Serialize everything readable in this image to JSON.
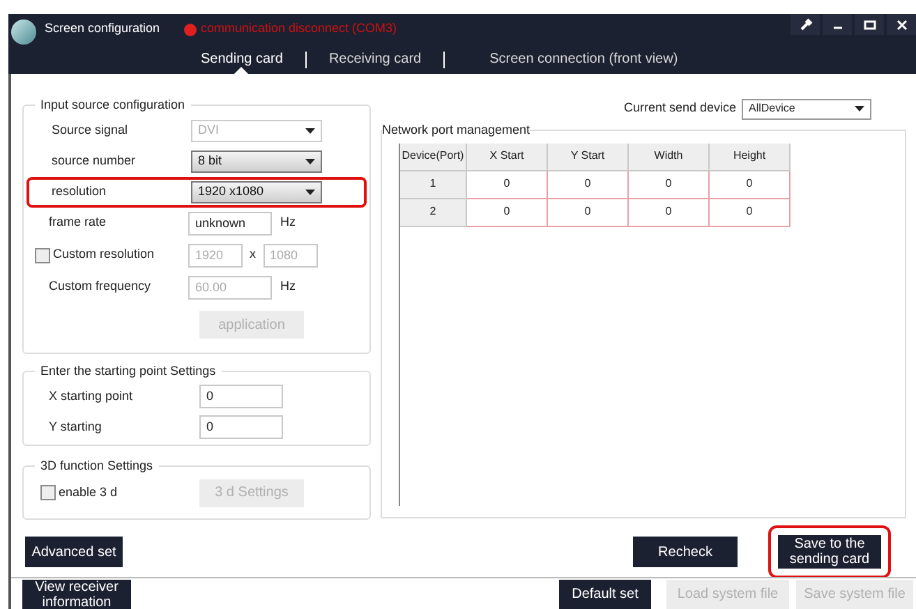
{
  "window": {
    "title": "Screen configuration",
    "status": {
      "text": "communication disconnect  (COM3)",
      "connected": false
    }
  },
  "tabs": [
    {
      "label": "Sending card",
      "selected": true
    },
    {
      "label": "Receiving card",
      "selected": false
    },
    {
      "label": "Screen connection (front view)",
      "selected": false
    }
  ],
  "input_source": {
    "legend": "Input source configuration",
    "rows": [
      {
        "kind": "select",
        "label": "Source signal",
        "value": "DVI",
        "disabled": true,
        "highlighted": false
      },
      {
        "kind": "select",
        "label": "source number",
        "value": "8 bit",
        "disabled": false,
        "highlighted": false
      },
      {
        "kind": "select",
        "label": "resolution",
        "value": "1920 x1080",
        "disabled": false,
        "highlighted": true
      },
      {
        "kind": "text",
        "label": "frame rate",
        "value": "unknown",
        "unit": "Hz",
        "disabled": false
      },
      {
        "kind": "pair",
        "label": "Custom resolution",
        "checked": false,
        "values": [
          "1920",
          "1080"
        ],
        "separator": "x",
        "disabled": true
      },
      {
        "kind": "text",
        "label": "Custom frequency",
        "value": "60.00",
        "unit": "Hz",
        "disabled": true
      }
    ],
    "button": {
      "label": "application",
      "disabled": true
    }
  },
  "starting_point": {
    "legend": "Enter the starting point Settings",
    "rows": [
      {
        "label": "X starting point",
        "value": "0"
      },
      {
        "label": "Y starting",
        "value": "0"
      }
    ]
  },
  "three_d": {
    "legend": "3D function Settings",
    "checkbox": {
      "label": "enable 3 d",
      "checked": false
    },
    "button": {
      "label": "3 d Settings",
      "disabled": true
    }
  },
  "current_send_device": {
    "label": "Current send device",
    "value": "AllDevice"
  },
  "network_port": {
    "legend": "Network port management",
    "columns": [
      "Device(Port)",
      "X Start",
      "Y Start",
      "Width",
      "Height"
    ],
    "rows": [
      [
        "1",
        "0",
        "0",
        "0",
        "0"
      ],
      [
        "2",
        "0",
        "0",
        "0",
        "0"
      ]
    ]
  },
  "buttons": [
    {
      "label": "Advanced set",
      "disabled": false,
      "highlighted": false
    },
    {
      "label": "Recheck",
      "disabled": false,
      "highlighted": false
    },
    {
      "label": "Save to the sending card",
      "disabled": false,
      "highlighted": true
    }
  ],
  "footer_buttons": [
    {
      "label": "View receiver information",
      "disabled": false
    },
    {
      "label": "Default set",
      "disabled": false
    },
    {
      "label": "Load system file",
      "disabled": true
    },
    {
      "label": "Save system file",
      "disabled": true
    }
  ]
}
